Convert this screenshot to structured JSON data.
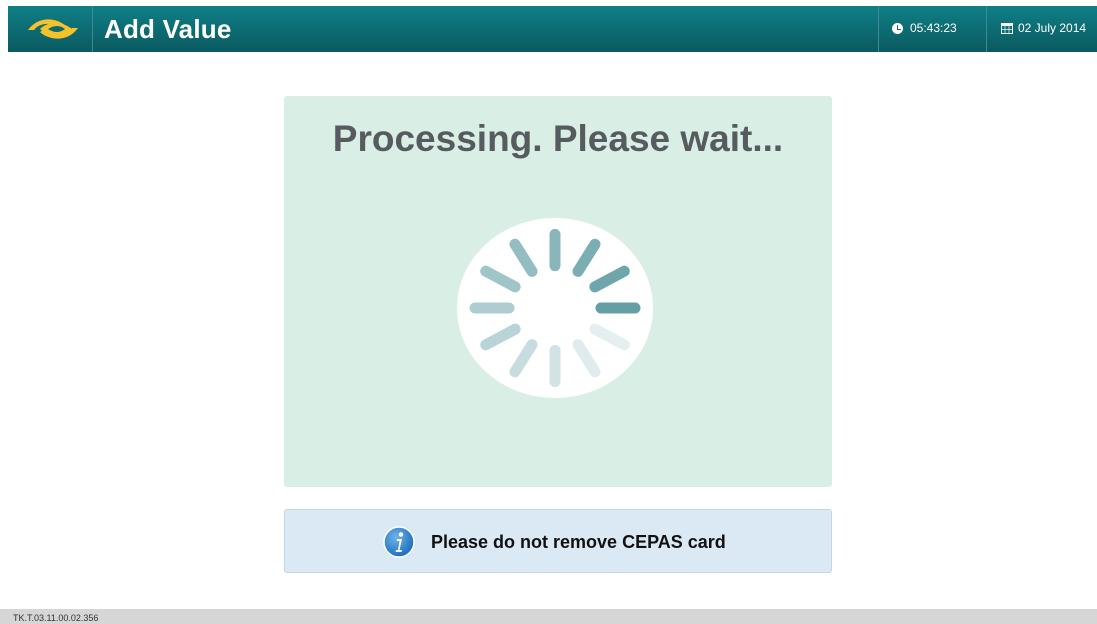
{
  "header": {
    "logo_icon": "transit-operator-logo-icon",
    "title": "Add Value",
    "time_icon": "clock-icon",
    "time": "05:43:23",
    "date_icon": "calendar-icon",
    "date": "02 July 2014",
    "colors": {
      "bar": "#0c6a70",
      "logo": "#f5c22b"
    }
  },
  "main": {
    "status_text": "Processing. Please wait...",
    "spinner_icon": "loading-spinner-icon",
    "panel_color": "#d9eee4"
  },
  "notice": {
    "icon": "info-icon",
    "text": "Please do not remove CEPAS card",
    "color": "#dbe9f5"
  },
  "footer": {
    "version": "TK.T.03.11.00.02.356"
  }
}
